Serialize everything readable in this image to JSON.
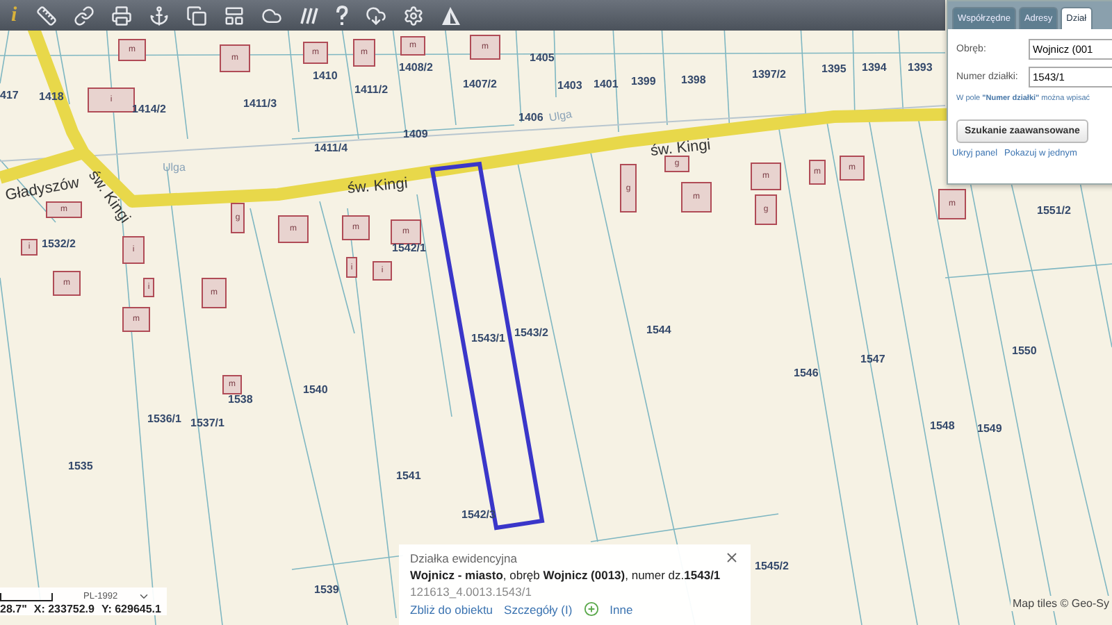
{
  "toolbar": {
    "label": "i"
  },
  "map": {
    "parcels": [
      "417",
      "1418",
      "1414/2",
      "1411/3",
      "1410",
      "1411/2",
      "1408/2",
      "1407/2",
      "1405",
      "1403",
      "1401",
      "1399",
      "1398",
      "1397/2",
      "1395",
      "1394",
      "1393",
      "1406",
      "1409",
      "1411/4",
      "1532/2",
      "1542/1",
      "1543/1",
      "1543/2",
      "1544",
      "1546",
      "1547",
      "1548",
      "1549",
      "1550",
      "1551/2",
      "1540",
      "1536/1",
      "1537/1",
      "1538",
      "1535",
      "1541",
      "1542/3",
      "1545/2",
      "1539"
    ],
    "streets": [
      "św. Kingi",
      "św. Kingi",
      "św. Kingi",
      "Gładyszów",
      "Ulga",
      "Ulga"
    ],
    "buildings": [
      "m",
      "m",
      "m",
      "m",
      "m",
      "m",
      "i",
      "m",
      "i",
      "m",
      "i",
      "i",
      "m",
      "g",
      "m",
      "m",
      "m",
      "i",
      "i",
      "m",
      "g",
      "g",
      "m",
      "m",
      "g",
      "m",
      "m",
      "m",
      "m"
    ]
  },
  "panel": {
    "tabs": [
      {
        "label": "Współrzędne",
        "selected": false
      },
      {
        "label": "Adresy",
        "selected": false
      },
      {
        "label": "Dział",
        "selected": true
      }
    ],
    "fields": [
      {
        "label": "Obręb:",
        "value": "Wojnicz (001"
      },
      {
        "label": "Numer działki:",
        "value": "1543/1"
      }
    ],
    "hint": "W pole **\"Numer działki\"** można wpisać",
    "button": "Szukanie zaawansowane",
    "links": [
      "Ukryj panel",
      "Pokazuj w jednym"
    ]
  },
  "popup": {
    "title": "Działka ewidencyjna",
    "description": "**Wojnicz - miasto**, obręb **Wojnicz (0013)**, numer dz.**1543/1**",
    "identifier": "121613_4.0013.1543/1",
    "links": [
      "Zbliż do obiektu",
      "Szczegóły (I)",
      "Inne"
    ]
  },
  "coordinates": {
    "system": "PL-1992",
    "scale": "28.7\"",
    "x": "X: 233752.9",
    "y": "Y: 629645.1"
  },
  "attribution": "Map tiles © Geo-Sy"
}
